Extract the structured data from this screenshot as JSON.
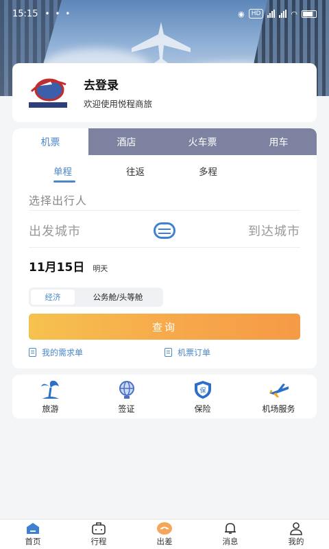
{
  "status_bar": {
    "time": "15:15",
    "dots": "• • •",
    "hd": "HD"
  },
  "login": {
    "title": "去登录",
    "subtitle": "欢迎使用悦程商旅"
  },
  "tabs": [
    {
      "label": "机票",
      "active": true
    },
    {
      "label": "酒店",
      "active": false
    },
    {
      "label": "火车票",
      "active": false
    },
    {
      "label": "用车",
      "active": false
    }
  ],
  "trip_types": [
    {
      "label": "单程",
      "active": true
    },
    {
      "label": "往返",
      "active": false
    },
    {
      "label": "多程",
      "active": false
    }
  ],
  "form": {
    "passenger_placeholder": "选择出行人",
    "from_city": "出发城市",
    "to_city": "到达城市",
    "date": "11月15日",
    "date_note": "明天",
    "cabin_selected": "经济",
    "cabin_other": "公务舱/头等舱",
    "query_label": "查询"
  },
  "links": {
    "my_requests": "我的需求单",
    "flight_orders": "机票订单"
  },
  "services": [
    {
      "label": "旅游",
      "icon": "palm-tree-icon"
    },
    {
      "label": "签证",
      "icon": "globe-icon"
    },
    {
      "label": "保险",
      "icon": "shield-icon"
    },
    {
      "label": "机场服务",
      "icon": "airplane-icon"
    }
  ],
  "bottom_nav": [
    {
      "label": "首页",
      "icon": "home-icon"
    },
    {
      "label": "行程",
      "icon": "briefcase-icon"
    },
    {
      "label": "出差",
      "icon": "travel-icon"
    },
    {
      "label": "消息",
      "icon": "bell-icon"
    },
    {
      "label": "我的",
      "icon": "user-icon"
    }
  ],
  "colors": {
    "accent": "#4a87c8",
    "tab_bar": "#7d82a0",
    "button_start": "#f6c24f",
    "button_end": "#f59a46"
  }
}
